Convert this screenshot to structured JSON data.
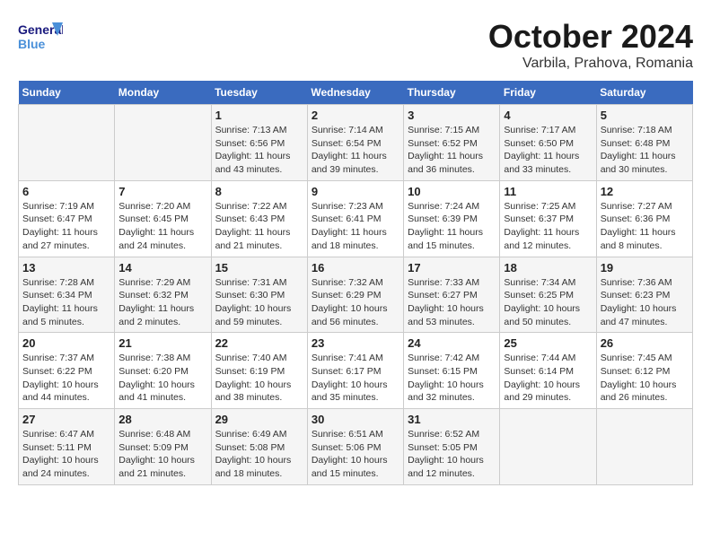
{
  "header": {
    "logo_general": "General",
    "logo_blue": "Blue",
    "month_title": "October 2024",
    "subtitle": "Varbila, Prahova, Romania"
  },
  "weekdays": [
    "Sunday",
    "Monday",
    "Tuesday",
    "Wednesday",
    "Thursday",
    "Friday",
    "Saturday"
  ],
  "weeks": [
    [
      {
        "day": "",
        "content": ""
      },
      {
        "day": "",
        "content": ""
      },
      {
        "day": "1",
        "content": "Sunrise: 7:13 AM\nSunset: 6:56 PM\nDaylight: 11 hours and 43 minutes."
      },
      {
        "day": "2",
        "content": "Sunrise: 7:14 AM\nSunset: 6:54 PM\nDaylight: 11 hours and 39 minutes."
      },
      {
        "day": "3",
        "content": "Sunrise: 7:15 AM\nSunset: 6:52 PM\nDaylight: 11 hours and 36 minutes."
      },
      {
        "day": "4",
        "content": "Sunrise: 7:17 AM\nSunset: 6:50 PM\nDaylight: 11 hours and 33 minutes."
      },
      {
        "day": "5",
        "content": "Sunrise: 7:18 AM\nSunset: 6:48 PM\nDaylight: 11 hours and 30 minutes."
      }
    ],
    [
      {
        "day": "6",
        "content": "Sunrise: 7:19 AM\nSunset: 6:47 PM\nDaylight: 11 hours and 27 minutes."
      },
      {
        "day": "7",
        "content": "Sunrise: 7:20 AM\nSunset: 6:45 PM\nDaylight: 11 hours and 24 minutes."
      },
      {
        "day": "8",
        "content": "Sunrise: 7:22 AM\nSunset: 6:43 PM\nDaylight: 11 hours and 21 minutes."
      },
      {
        "day": "9",
        "content": "Sunrise: 7:23 AM\nSunset: 6:41 PM\nDaylight: 11 hours and 18 minutes."
      },
      {
        "day": "10",
        "content": "Sunrise: 7:24 AM\nSunset: 6:39 PM\nDaylight: 11 hours and 15 minutes."
      },
      {
        "day": "11",
        "content": "Sunrise: 7:25 AM\nSunset: 6:37 PM\nDaylight: 11 hours and 12 minutes."
      },
      {
        "day": "12",
        "content": "Sunrise: 7:27 AM\nSunset: 6:36 PM\nDaylight: 11 hours and 8 minutes."
      }
    ],
    [
      {
        "day": "13",
        "content": "Sunrise: 7:28 AM\nSunset: 6:34 PM\nDaylight: 11 hours and 5 minutes."
      },
      {
        "day": "14",
        "content": "Sunrise: 7:29 AM\nSunset: 6:32 PM\nDaylight: 11 hours and 2 minutes."
      },
      {
        "day": "15",
        "content": "Sunrise: 7:31 AM\nSunset: 6:30 PM\nDaylight: 10 hours and 59 minutes."
      },
      {
        "day": "16",
        "content": "Sunrise: 7:32 AM\nSunset: 6:29 PM\nDaylight: 10 hours and 56 minutes."
      },
      {
        "day": "17",
        "content": "Sunrise: 7:33 AM\nSunset: 6:27 PM\nDaylight: 10 hours and 53 minutes."
      },
      {
        "day": "18",
        "content": "Sunrise: 7:34 AM\nSunset: 6:25 PM\nDaylight: 10 hours and 50 minutes."
      },
      {
        "day": "19",
        "content": "Sunrise: 7:36 AM\nSunset: 6:23 PM\nDaylight: 10 hours and 47 minutes."
      }
    ],
    [
      {
        "day": "20",
        "content": "Sunrise: 7:37 AM\nSunset: 6:22 PM\nDaylight: 10 hours and 44 minutes."
      },
      {
        "day": "21",
        "content": "Sunrise: 7:38 AM\nSunset: 6:20 PM\nDaylight: 10 hours and 41 minutes."
      },
      {
        "day": "22",
        "content": "Sunrise: 7:40 AM\nSunset: 6:19 PM\nDaylight: 10 hours and 38 minutes."
      },
      {
        "day": "23",
        "content": "Sunrise: 7:41 AM\nSunset: 6:17 PM\nDaylight: 10 hours and 35 minutes."
      },
      {
        "day": "24",
        "content": "Sunrise: 7:42 AM\nSunset: 6:15 PM\nDaylight: 10 hours and 32 minutes."
      },
      {
        "day": "25",
        "content": "Sunrise: 7:44 AM\nSunset: 6:14 PM\nDaylight: 10 hours and 29 minutes."
      },
      {
        "day": "26",
        "content": "Sunrise: 7:45 AM\nSunset: 6:12 PM\nDaylight: 10 hours and 26 minutes."
      }
    ],
    [
      {
        "day": "27",
        "content": "Sunrise: 6:47 AM\nSunset: 5:11 PM\nDaylight: 10 hours and 24 minutes."
      },
      {
        "day": "28",
        "content": "Sunrise: 6:48 AM\nSunset: 5:09 PM\nDaylight: 10 hours and 21 minutes."
      },
      {
        "day": "29",
        "content": "Sunrise: 6:49 AM\nSunset: 5:08 PM\nDaylight: 10 hours and 18 minutes."
      },
      {
        "day": "30",
        "content": "Sunrise: 6:51 AM\nSunset: 5:06 PM\nDaylight: 10 hours and 15 minutes."
      },
      {
        "day": "31",
        "content": "Sunrise: 6:52 AM\nSunset: 5:05 PM\nDaylight: 10 hours and 12 minutes."
      },
      {
        "day": "",
        "content": ""
      },
      {
        "day": "",
        "content": ""
      }
    ]
  ]
}
